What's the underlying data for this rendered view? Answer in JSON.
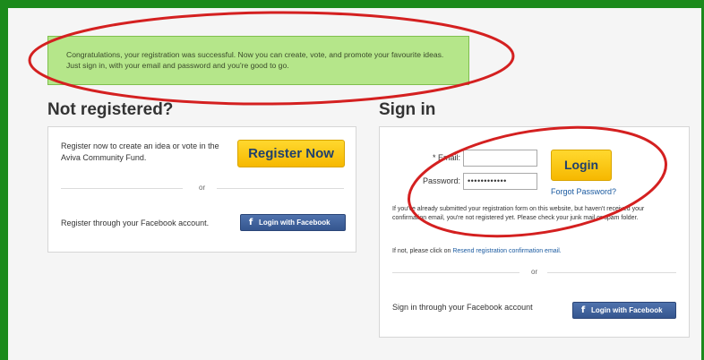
{
  "banner": {
    "message": "Congratulations, your registration was successful. Now you can create, vote, and promote your favourite ideas. Just sign in, with your email and password and you're good to go."
  },
  "register": {
    "heading": "Not registered?",
    "intro": "Register now to create an idea or vote in the Aviva Community Fund.",
    "button_label": "Register Now",
    "or_text": "or",
    "facebook_text": "Register through your Facebook account.",
    "facebook_button_label": "Login with Facebook"
  },
  "signin": {
    "heading": "Sign in",
    "email_label": "* Email:",
    "email_value": "",
    "password_label": "Password:",
    "password_value": "••••••••••••",
    "login_label": "Login",
    "forgot_link": "Forgot Password?",
    "notice": "If you've already submitted your registration form on this website, but haven't received your confirmation email, you're not registered yet. Please check your junk mail or spam folder.",
    "resend_prefix": "If not, please click on",
    "resend_link": "Resend registration confirmation email.",
    "or_text": "or",
    "facebook_text": "Sign in through your Facebook account",
    "facebook_button_label": "Login with Facebook"
  },
  "colors": {
    "frame": "#1c8a1c",
    "success_bg": "#b5e68a",
    "button_yellow": "#f6b800",
    "facebook_blue": "#3b5998",
    "annotation_red": "#d42020"
  }
}
